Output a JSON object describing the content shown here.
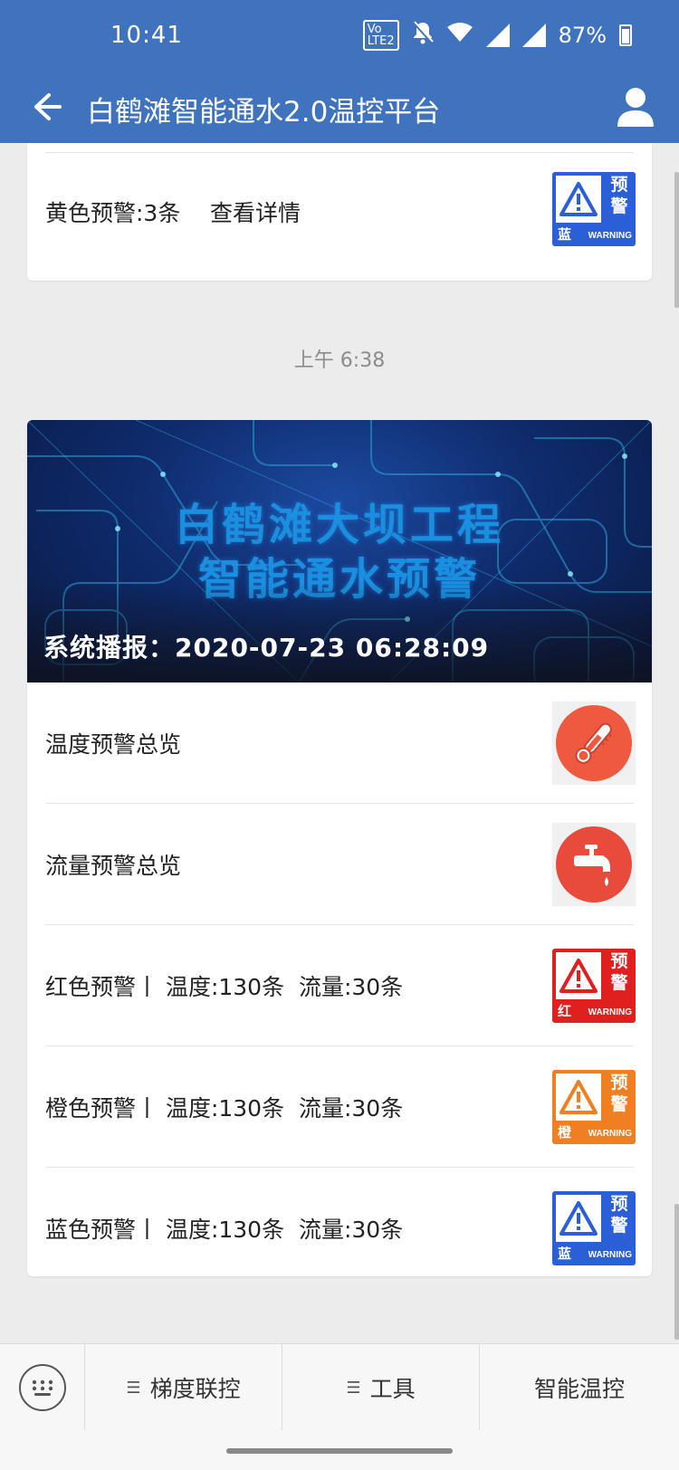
{
  "status_bar": {
    "time": "10:41",
    "volte": "VoLTE2",
    "battery": "87%",
    "icons": [
      "volte-icon",
      "mute-bell-icon",
      "wifi-icon",
      "signal-icon",
      "signal-icon",
      "battery-icon"
    ]
  },
  "app_bar": {
    "title": "白鹤滩智能通水2.0温控平台",
    "back_icon": "back-arrow-icon",
    "user_icon": "user-icon",
    "color": "#3f73bd"
  },
  "previous_message": {
    "summary": "黄色预警:3条",
    "link": "查看详情",
    "badge": {
      "word": "预警",
      "color_label": "蓝",
      "warning": "WARNING",
      "bg": "#2b5fd8"
    }
  },
  "timestamp": "上午 6:38",
  "article": {
    "banner": {
      "line1": "白鹤滩大坝工程",
      "line2": "智能通水预警",
      "broadcast": "系统播报：2020-07-23 06:28:09"
    },
    "rows": [
      {
        "label": "温度预警总览",
        "icon": "thermometer-icon",
        "icon_bg": "#ee5a3f"
      },
      {
        "label": "流量预警总览",
        "icon": "faucet-icon",
        "icon_bg": "#e84a3c"
      },
      {
        "label": "红色预警丨 温度:130条  流量:30条",
        "badge": {
          "word": "预警",
          "color_label": "红",
          "warning": "WARNING",
          "bg": "#e0201f"
        }
      },
      {
        "label": "橙色预警丨 温度:130条  流量:30条",
        "badge": {
          "word": "预警",
          "color_label": "橙",
          "warning": "WARNING",
          "bg": "#f07f22"
        }
      },
      {
        "label": "蓝色预警丨 温度:130条  流量:30条",
        "badge": {
          "word": "预警",
          "color_label": "蓝",
          "warning": "WARNING",
          "bg": "#2b5fd8"
        }
      }
    ]
  },
  "bottom_menu": {
    "keyboard_icon": "keyboard-icon",
    "items": [
      "梯度联控",
      "工具",
      "智能温控"
    ]
  }
}
